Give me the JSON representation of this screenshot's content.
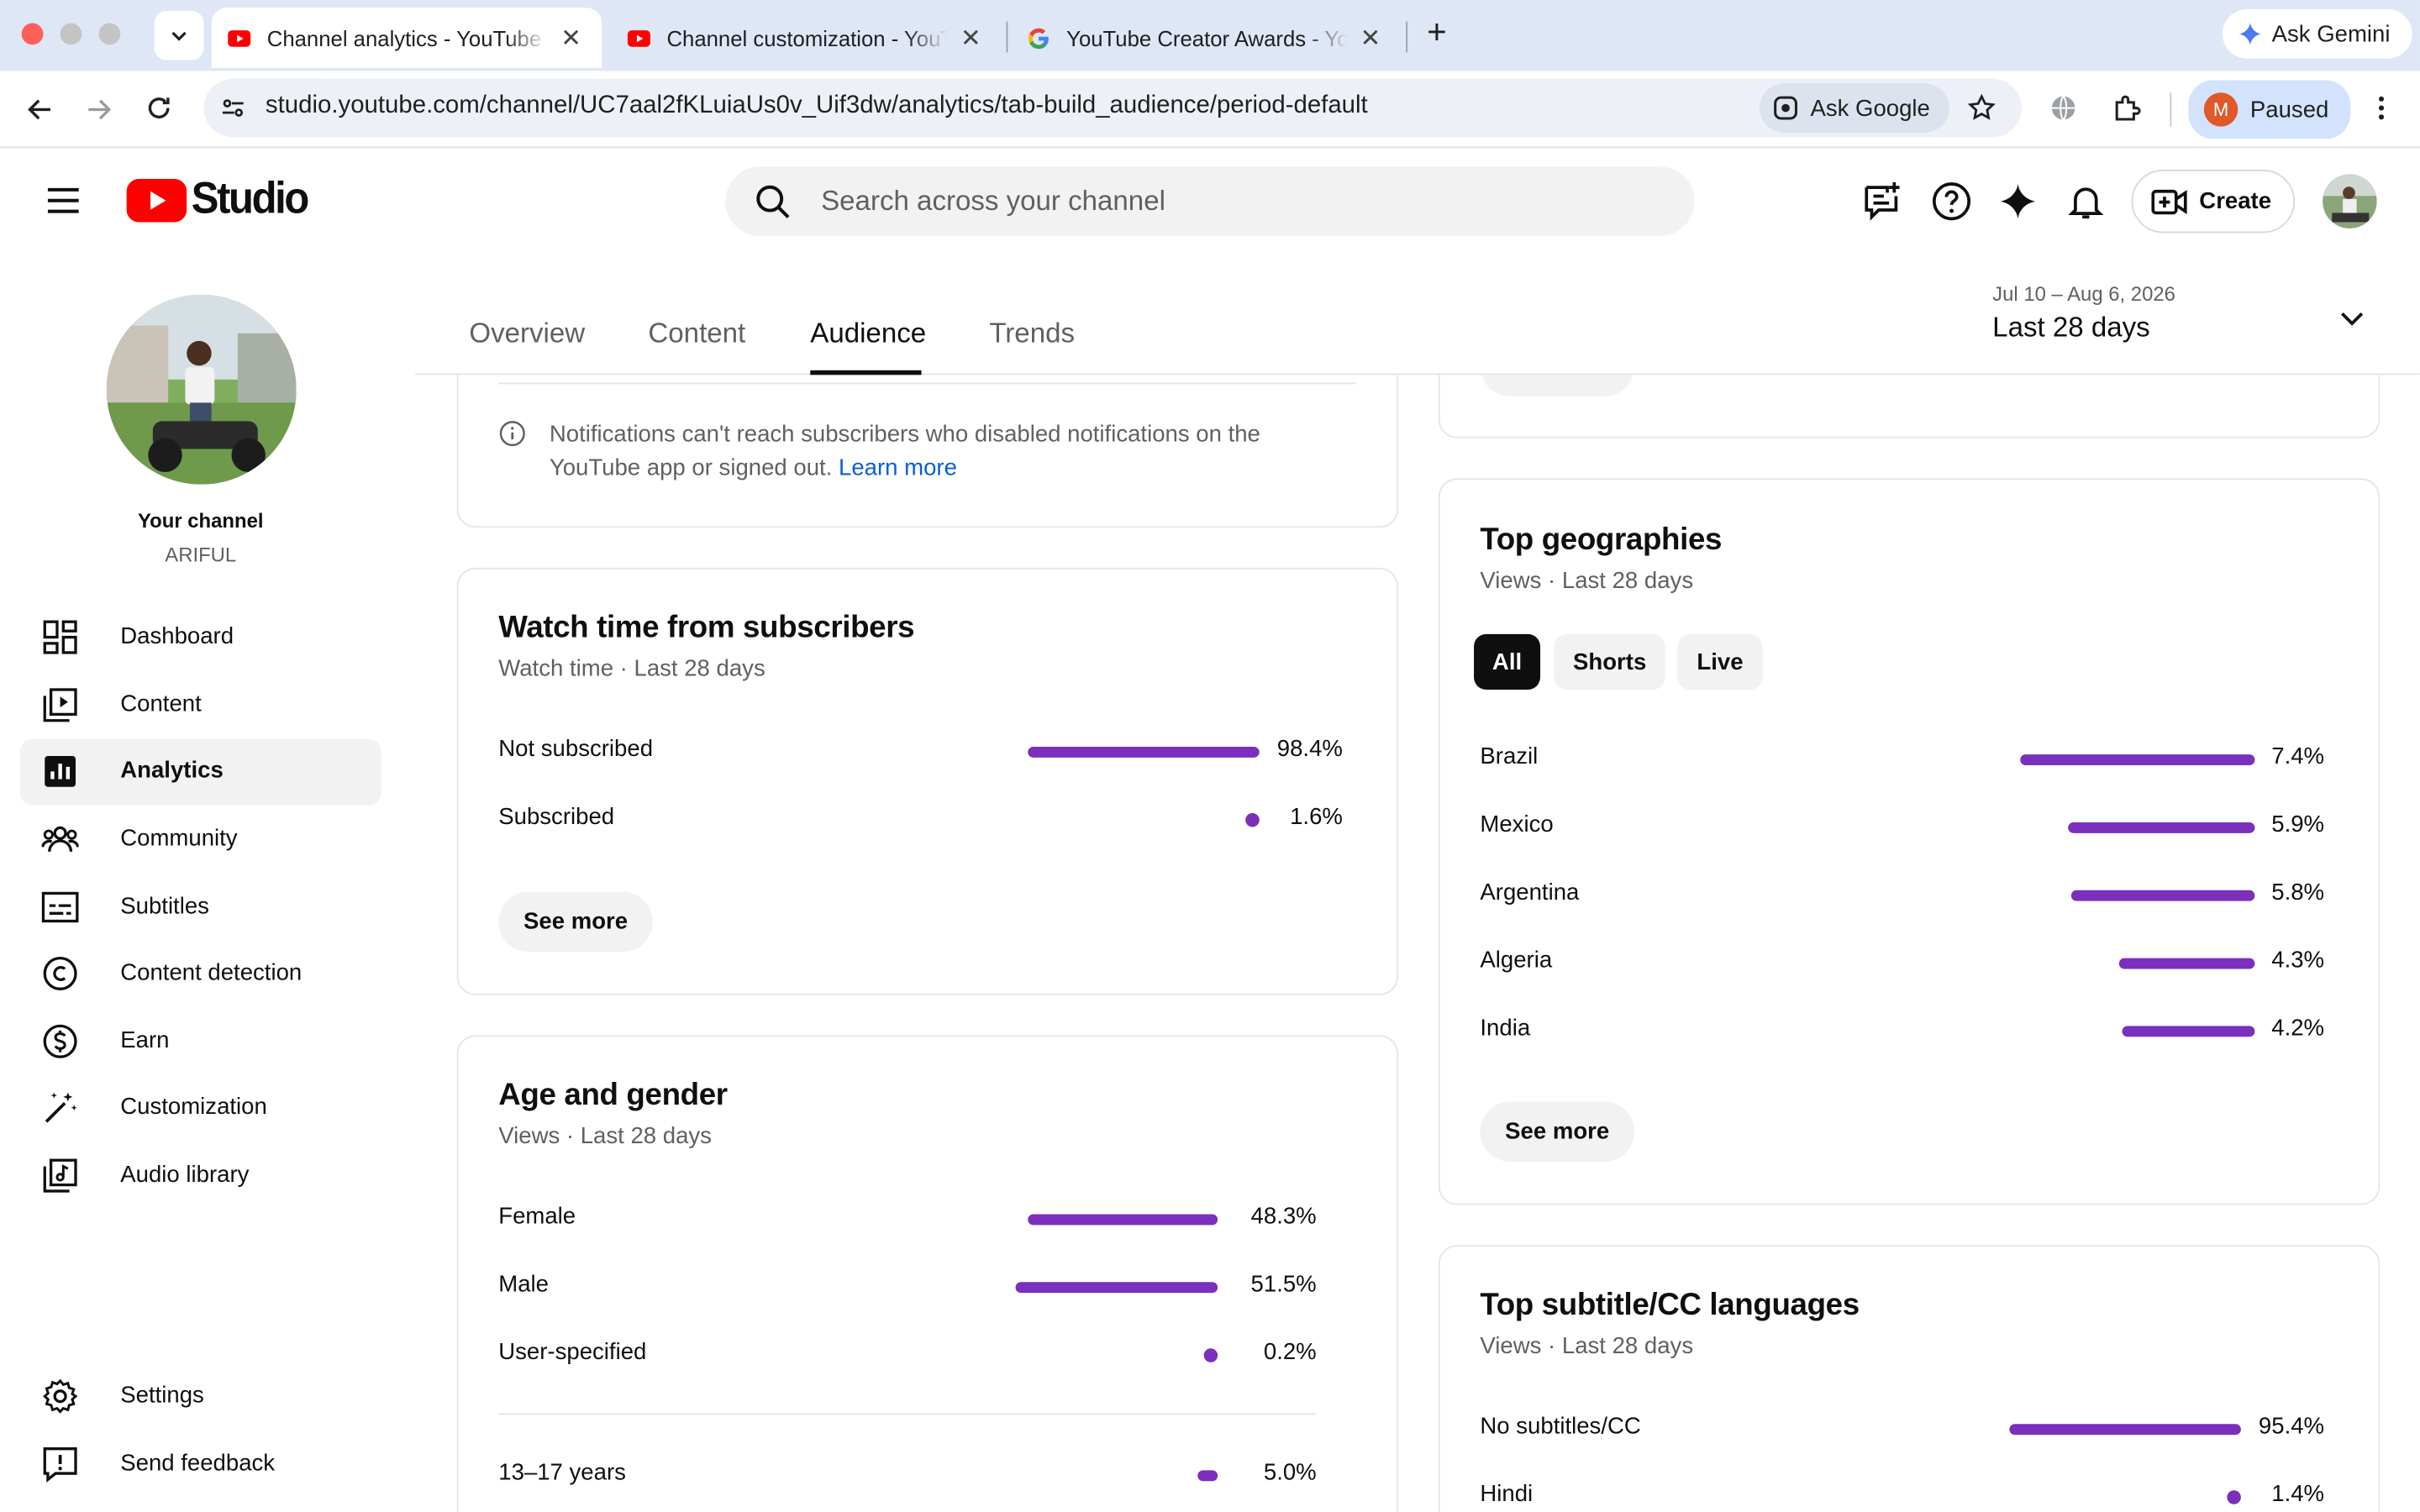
{
  "browser": {
    "tabs": [
      {
        "title": "Channel analytics - YouTube Studio"
      },
      {
        "title": "Channel customization - YouTube Studio"
      },
      {
        "title": "YouTube Creator Awards - YouTube"
      }
    ],
    "new_tab": "+",
    "close_glyph": "✕",
    "gemini_label": "Ask Gemini",
    "url": "studio.youtube.com/channel/UC7aal2fKLuiaUs0v_Uif3dw/analytics/tab-build_audience/period-default",
    "ask_google": "Ask Google",
    "profile_initial": "M",
    "profile_label": "Paused"
  },
  "header": {
    "logo_text": "Studio",
    "search_placeholder": "Search across your channel",
    "create_label": "Create"
  },
  "sidebar": {
    "channel_label": "Your channel",
    "channel_name": "ARIFUL",
    "items": [
      {
        "label": "Dashboard",
        "icon": "dashboard-icon"
      },
      {
        "label": "Content",
        "icon": "content-icon"
      },
      {
        "label": "Analytics",
        "icon": "analytics-icon",
        "active": true
      },
      {
        "label": "Community",
        "icon": "community-icon"
      },
      {
        "label": "Subtitles",
        "icon": "subtitles-icon"
      },
      {
        "label": "Content detection",
        "icon": "copyright-icon"
      },
      {
        "label": "Earn",
        "icon": "dollar-icon"
      },
      {
        "label": "Customization",
        "icon": "magic-wand-icon"
      },
      {
        "label": "Audio library",
        "icon": "audio-library-icon"
      }
    ],
    "settings_label": "Settings",
    "feedback_label": "Send feedback"
  },
  "analytics": {
    "tabs": [
      "Overview",
      "Content",
      "Audience",
      "Trends"
    ],
    "active_tab": "Audience",
    "date_range": "Jul 10 – Aug 6, 2026",
    "period_label": "Last 28 days"
  },
  "notification_card": {
    "text": "Notifications can't reach subscribers who disabled notifications on the YouTube app or signed out.",
    "link": "Learn more"
  },
  "watch_time": {
    "title": "Watch time from subscribers",
    "subtitle": "Watch time · Last 28 days",
    "rows": [
      {
        "label": "Not subscribed",
        "pct": "98.4%",
        "value": 98.4
      },
      {
        "label": "Subscribed",
        "pct": "1.6%",
        "value": 1.6
      }
    ],
    "see_more": "See more"
  },
  "age_gender": {
    "title": "Age and gender",
    "subtitle": "Views · Last 28 days",
    "gender_rows": [
      {
        "label": "Female",
        "pct": "48.3%",
        "value": 48.3
      },
      {
        "label": "Male",
        "pct": "51.5%",
        "value": 51.5
      },
      {
        "label": "User-specified",
        "pct": "0.2%",
        "value": 0.2
      }
    ],
    "age_rows": [
      {
        "label": "13–17 years",
        "pct": "5.0%",
        "value": 5.0
      }
    ]
  },
  "top_geographies": {
    "title": "Top geographies",
    "subtitle": "Views · Last 28 days",
    "filters": [
      "All",
      "Shorts",
      "Live"
    ],
    "active_filter": "All",
    "rows": [
      {
        "label": "Brazil",
        "pct": "7.4%",
        "value": 7.4
      },
      {
        "label": "Mexico",
        "pct": "5.9%",
        "value": 5.9
      },
      {
        "label": "Argentina",
        "pct": "5.8%",
        "value": 5.8
      },
      {
        "label": "Algeria",
        "pct": "4.3%",
        "value": 4.3
      },
      {
        "label": "India",
        "pct": "4.2%",
        "value": 4.2
      }
    ],
    "see_more": "See more"
  },
  "subtitle_languages": {
    "title": "Top subtitle/CC languages",
    "subtitle": "Views · Last 28 days",
    "rows": [
      {
        "label": "No subtitles/CC",
        "pct": "95.4%",
        "value": 95.4
      },
      {
        "label": "Hindi",
        "pct": "1.4%",
        "value": 1.4
      }
    ]
  },
  "colors": {
    "accent_purple": "#7a2fbd",
    "youtube_red": "#ff0000",
    "link_blue": "#065fd4",
    "chrome_tabbar": "#dfe6f5"
  }
}
